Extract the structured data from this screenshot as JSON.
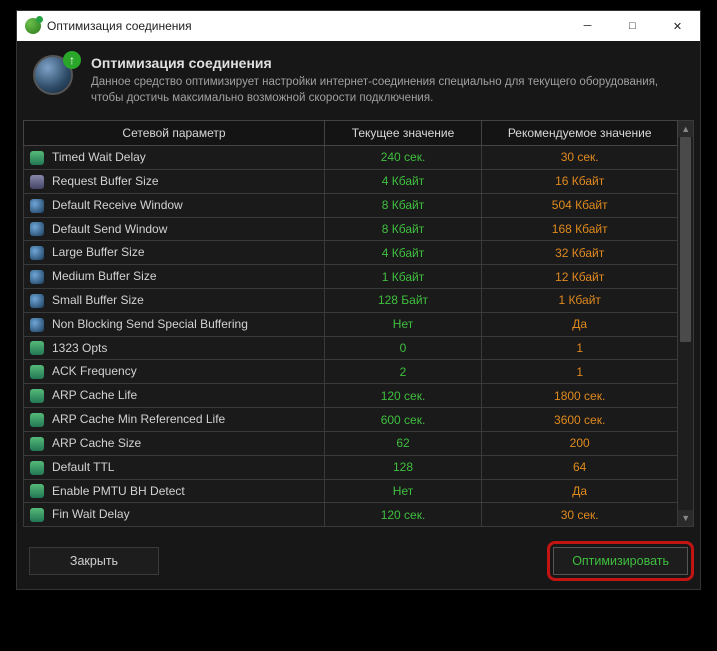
{
  "titlebar": {
    "title": "Оптимизация соединения"
  },
  "header": {
    "heading": "Оптимизация соединения",
    "subtext": "Данное средство оптимизирует настройки интернет-соединения специально для текущего оборудования, чтобы достичь максимально возможной скорости подключения."
  },
  "columns": {
    "param": "Сетевой параметр",
    "current": "Текущее значение",
    "recommended": "Рекомендуемое значение"
  },
  "rows": [
    {
      "icon": "ico-net",
      "name": "Timed Wait Delay",
      "cur": "240 сек.",
      "rec": "30 сек."
    },
    {
      "icon": "ico-mon",
      "name": "Request Buffer Size",
      "cur": "4 Кбайт",
      "rec": "16 Кбайт"
    },
    {
      "icon": "ico-glb",
      "name": "Default Receive Window",
      "cur": "8 Кбайт",
      "rec": "504 Кбайт"
    },
    {
      "icon": "ico-glb",
      "name": "Default Send Window",
      "cur": "8 Кбайт",
      "rec": "168 Кбайт"
    },
    {
      "icon": "ico-glb",
      "name": "Large Buffer Size",
      "cur": "4 Кбайт",
      "rec": "32 Кбайт"
    },
    {
      "icon": "ico-glb",
      "name": "Medium Buffer Size",
      "cur": "1 Кбайт",
      "rec": "12 Кбайт"
    },
    {
      "icon": "ico-glb",
      "name": "Small Buffer Size",
      "cur": "128 Байт",
      "rec": "1 Кбайт"
    },
    {
      "icon": "ico-glb",
      "name": "Non Blocking Send Special Buffering",
      "cur": "Нет",
      "rec": "Да"
    },
    {
      "icon": "ico-net",
      "name": "1323 Opts",
      "cur": "0",
      "rec": "1"
    },
    {
      "icon": "ico-net",
      "name": "ACK Frequency",
      "cur": "2",
      "rec": "1"
    },
    {
      "icon": "ico-net",
      "name": "ARP Cache Life",
      "cur": "120 сек.",
      "rec": "1800 сек."
    },
    {
      "icon": "ico-net",
      "name": "ARP Cache Min Referenced Life",
      "cur": "600 сек.",
      "rec": "3600 сек."
    },
    {
      "icon": "ico-net",
      "name": "ARP Cache Size",
      "cur": "62",
      "rec": "200"
    },
    {
      "icon": "ico-net",
      "name": "Default TTL",
      "cur": "128",
      "rec": "64"
    },
    {
      "icon": "ico-net",
      "name": "Enable PMTU BH Detect",
      "cur": "Нет",
      "rec": "Да"
    },
    {
      "icon": "ico-net",
      "name": "Fin Wait Delay",
      "cur": "120 сек.",
      "rec": "30 сек."
    }
  ],
  "buttons": {
    "close": "Закрыть",
    "optimize": "Оптимизировать"
  }
}
